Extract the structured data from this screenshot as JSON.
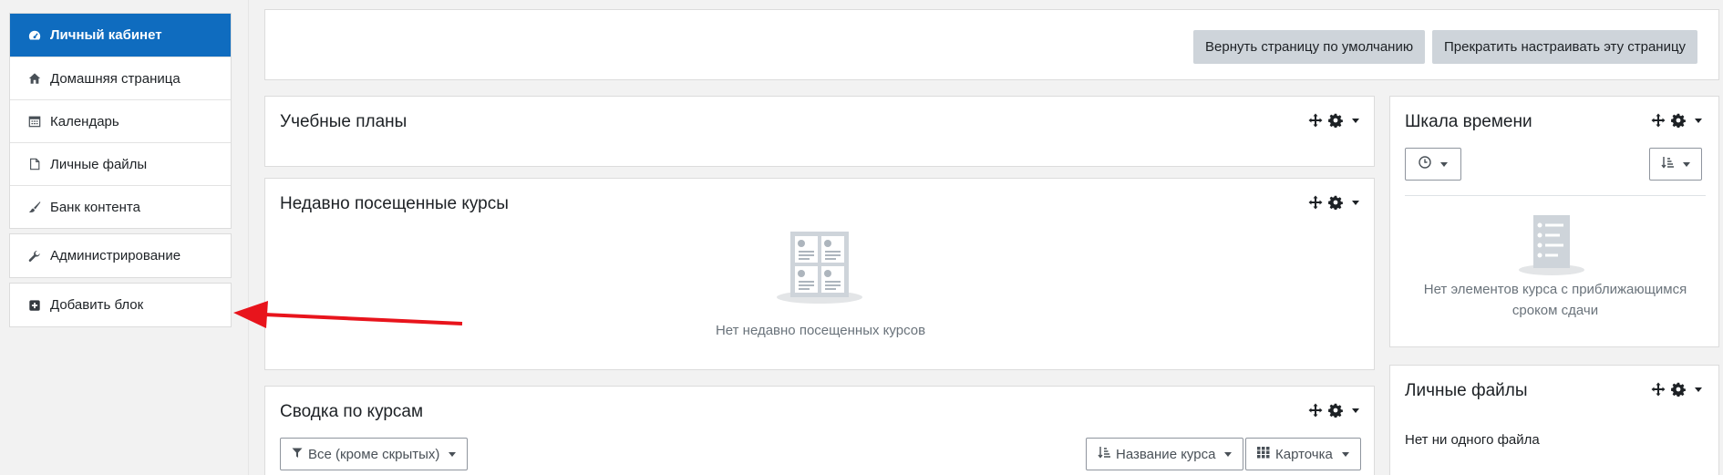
{
  "sidebar": {
    "main_items": [
      {
        "label": "Личный кабинет",
        "icon": "dashboard-icon",
        "active": true
      },
      {
        "label": "Домашняя страница",
        "icon": "home-icon"
      },
      {
        "label": "Календарь",
        "icon": "calendar-icon"
      },
      {
        "label": "Личные файлы",
        "icon": "file-icon"
      },
      {
        "label": "Банк контента",
        "icon": "brush-icon"
      }
    ],
    "admin_label": "Администрирование",
    "add_block_label": "Добавить блок"
  },
  "header_buttons": {
    "reset": "Вернуть страницу по умолчанию",
    "stop_customise": "Прекратить настраивать эту страницу"
  },
  "blocks": {
    "learning_plans": {
      "title": "Учебные планы"
    },
    "recent_courses": {
      "title": "Недавно посещенные курсы",
      "empty": "Нет недавно посещенных курсов"
    },
    "course_overview": {
      "title": "Сводка по курсам",
      "filter": "Все (кроме скрытых)",
      "sort": "Название курса",
      "view": "Карточка"
    },
    "timeline": {
      "title": "Шкала времени",
      "empty_line1": "Нет элементов курса с приближающимся",
      "empty_line2": "сроком сдачи"
    },
    "private_files": {
      "title": "Личные файлы",
      "empty": "Нет ни одного файла"
    }
  },
  "colors": {
    "accent": "#0f6cbf",
    "annotation_arrow": "#e8141c"
  }
}
